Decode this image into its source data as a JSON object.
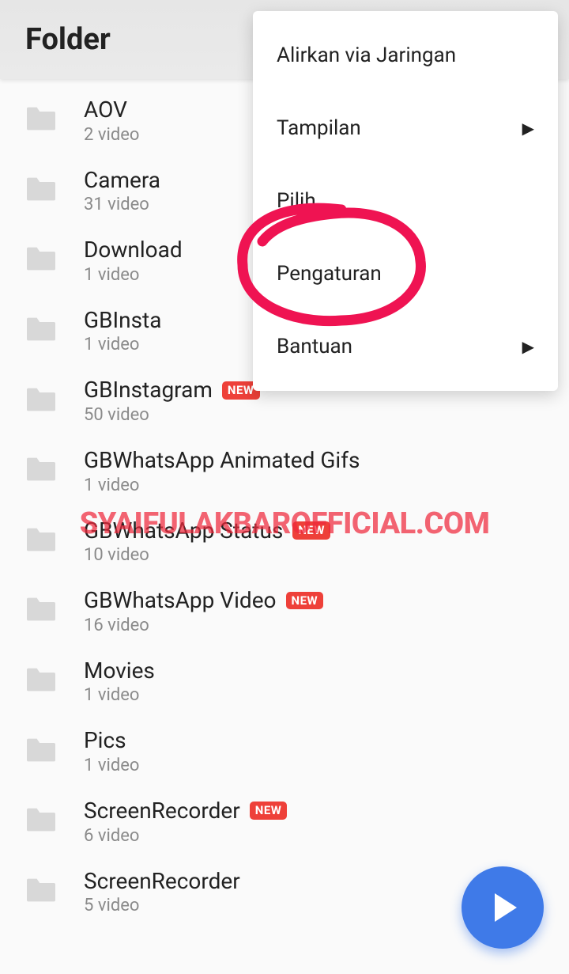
{
  "header": {
    "title": "Folder"
  },
  "newBadge": "NEW",
  "folders": [
    {
      "name": "AOV",
      "sub": "2 video",
      "isNew": false
    },
    {
      "name": "Camera",
      "sub": "31 video",
      "isNew": false
    },
    {
      "name": "Download",
      "sub": "1 video",
      "isNew": false
    },
    {
      "name": "GBInsta",
      "sub": "1 video",
      "isNew": false
    },
    {
      "name": "GBInstagram",
      "sub": "50 video",
      "isNew": true
    },
    {
      "name": "GBWhatsApp Animated Gifs",
      "sub": "1 video",
      "isNew": false
    },
    {
      "name": "GBWhatsApp Status",
      "sub": "10 video",
      "isNew": true
    },
    {
      "name": "GBWhatsApp Video",
      "sub": "16 video",
      "isNew": true
    },
    {
      "name": "Movies",
      "sub": "1 video",
      "isNew": false
    },
    {
      "name": "Pics",
      "sub": "1 video",
      "isNew": false
    },
    {
      "name": "ScreenRecorder",
      "sub": "6 video",
      "isNew": true
    },
    {
      "name": "ScreenRecorder",
      "sub": "5 video",
      "isNew": false
    }
  ],
  "menu": {
    "items": [
      {
        "label": "Alirkan via Jaringan",
        "hasArrow": false
      },
      {
        "label": "Tampilan",
        "hasArrow": true
      },
      {
        "label": "Pilih",
        "hasArrow": false
      },
      {
        "label": "Pengaturan",
        "hasArrow": false
      },
      {
        "label": "Bantuan",
        "hasArrow": true
      }
    ]
  },
  "watermark": "SYAIFULAKBAROFFICIAL.COM",
  "annotation": {
    "circled_menu_item": "Pengaturan",
    "color": "#ef1352"
  }
}
